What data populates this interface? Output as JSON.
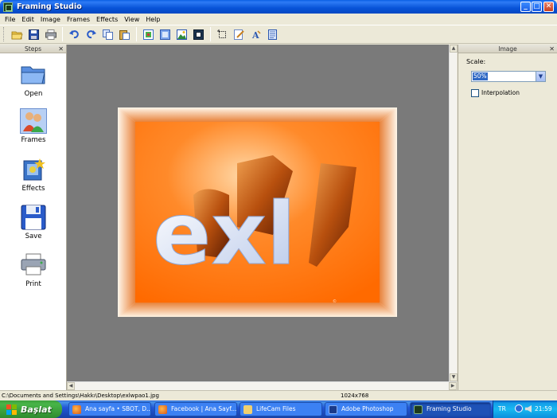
{
  "window": {
    "title": "Framing Studio",
    "controls": {
      "minimize": "_",
      "maximize": "□",
      "close": "✕"
    }
  },
  "menu": [
    "File",
    "Edit",
    "Image",
    "Frames",
    "Effects",
    "View",
    "Help"
  ],
  "toolbar": {
    "groups": [
      [
        "open-folder-icon",
        "save-disk-icon",
        "print-icon"
      ],
      [
        "undo-icon",
        "redo-icon",
        "copy-icon",
        "paste-icon"
      ],
      [
        "frame-tool-icon",
        "frame-tool-2-icon",
        "picture-icon",
        "crop-frame-icon"
      ],
      [
        "select-icon",
        "edit-icon",
        "text-icon",
        "properties-icon"
      ]
    ]
  },
  "steps_panel": {
    "title": "Steps",
    "close": "✕",
    "items": [
      {
        "label": "Open",
        "icon": "open-folder-icon"
      },
      {
        "label": "Frames",
        "icon": "frames-people-icon"
      },
      {
        "label": "Effects",
        "icon": "effects-icon"
      },
      {
        "label": "Save",
        "icon": "floppy-disk-icon"
      },
      {
        "label": "Print",
        "icon": "printer-icon"
      }
    ]
  },
  "image_panel": {
    "title": "Image",
    "close": "✕",
    "scale_label": "Scale:",
    "scale_value": "50%",
    "interpolation_label": "Interpolation",
    "interpolation_checked": false
  },
  "canvas": {
    "picture_text": "exl",
    "frame_color": "#f4a060",
    "background_color": "#ff7a1a"
  },
  "statusbar": {
    "path": "C:\\Documents and Settings\\Hakkı\\Desktop\\exlwpao1.jpg",
    "dimensions": "1024x768"
  },
  "taskbar": {
    "start_label": "Başlat",
    "tasks": [
      {
        "label": "Ana sayfa • SBOT, D...",
        "active": false
      },
      {
        "label": "Facebook | Ana Sayf...",
        "active": false
      },
      {
        "label": "LifeCam Files",
        "active": false
      },
      {
        "label": "Adobe Photoshop",
        "active": false
      },
      {
        "label": "Framing Studio",
        "active": true
      }
    ],
    "tray_language": "TR",
    "clock": "21:59"
  }
}
